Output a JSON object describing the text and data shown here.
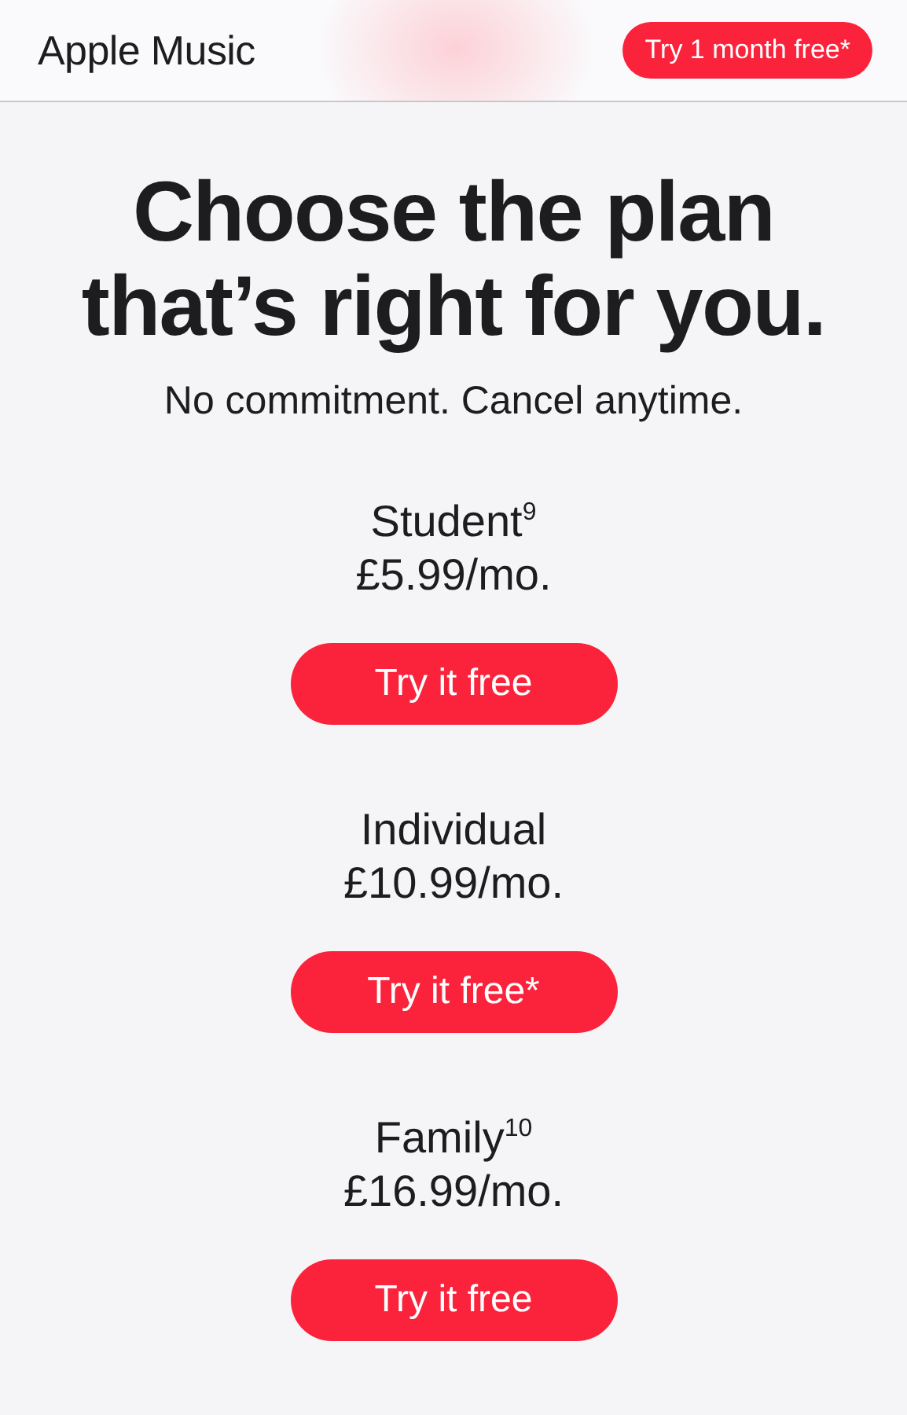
{
  "header": {
    "title": "Apple Music",
    "cta": "Try 1 month free*"
  },
  "headline": "Choose the plan that’s right for you.",
  "subheadline": "No commitment. Cancel anytime.",
  "plans": [
    {
      "name": "Student$^{9}$",
      "price": "£5.99/mo.",
      "button": "Try it free"
    },
    {
      "name": "Individual",
      "price": "£10.99/mo.",
      "button": "Try it free*"
    },
    {
      "name": "Family$^{10}$",
      "price": "£16.99/mo.",
      "button": "Try it free"
    }
  ]
}
